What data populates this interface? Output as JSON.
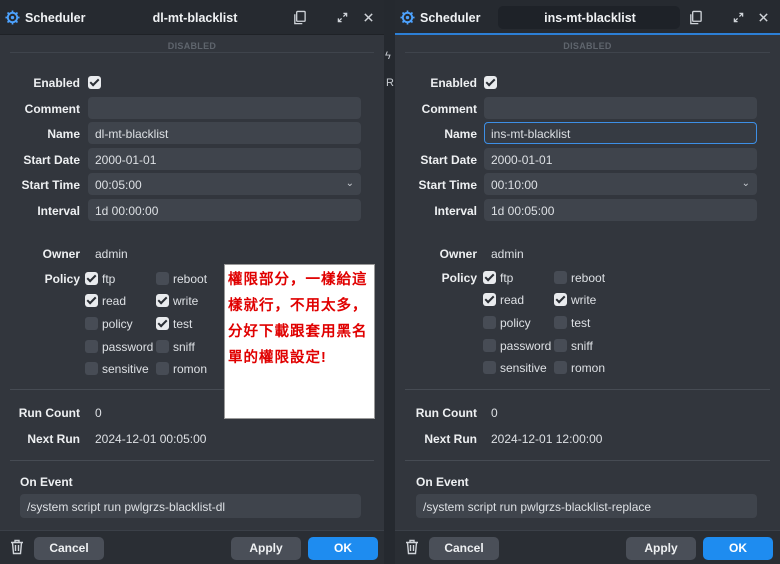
{
  "app_name": "Scheduler",
  "state_label": "DISABLED",
  "labels": {
    "enabled": "Enabled",
    "comment": "Comment",
    "name": "Name",
    "start_date": "Start Date",
    "start_time": "Start Time",
    "interval": "Interval",
    "owner": "Owner",
    "policy": "Policy",
    "run_count": "Run Count",
    "next_run": "Next Run",
    "on_event": "On Event"
  },
  "buttons": {
    "cancel": "Cancel",
    "apply": "Apply",
    "ok": "OK"
  },
  "policy_names": {
    "ftp": "ftp",
    "reboot": "reboot",
    "read": "read",
    "write": "write",
    "policy": "policy",
    "test": "test",
    "password": "password",
    "sniff": "sniff",
    "sensitive": "sensitive",
    "romon": "romon"
  },
  "left_window": {
    "title": "dl-mt-blacklist",
    "enabled": true,
    "comment": "",
    "name": "dl-mt-blacklist",
    "start_date": "2000-01-01",
    "start_time": "00:05:00",
    "interval": "1d 00:00:00",
    "owner": "admin",
    "policy": {
      "ftp": true,
      "reboot": false,
      "read": true,
      "write": true,
      "policy": false,
      "test": true,
      "password": false,
      "sniff": false,
      "sensitive": false,
      "romon": false
    },
    "run_count": "0",
    "next_run": "2024-12-01 00:05:00",
    "on_event": "/system script run pwlgrzs-blacklist-dl"
  },
  "right_window": {
    "title": "ins-mt-blacklist",
    "enabled": true,
    "comment": "",
    "name": "ins-mt-blacklist",
    "start_date": "2000-01-01",
    "start_time": "00:10:00",
    "interval": "1d 00:05:00",
    "owner": "admin",
    "policy": {
      "ftp": true,
      "reboot": false,
      "read": true,
      "write": true,
      "policy": false,
      "test": false,
      "password": false,
      "sniff": false,
      "sensitive": false,
      "romon": false
    },
    "run_count": "0",
    "next_run": "2024-12-01 12:00:00",
    "on_event": "/system script run pwlgrzs-blacklist-replace"
  },
  "annotation_note": "權限部分，一樣給這樣就行，不用太多，分好下載跟套用黑名單的權限設定!",
  "colors": {
    "accent": "#1e8cf0",
    "note_text": "#e00000"
  }
}
